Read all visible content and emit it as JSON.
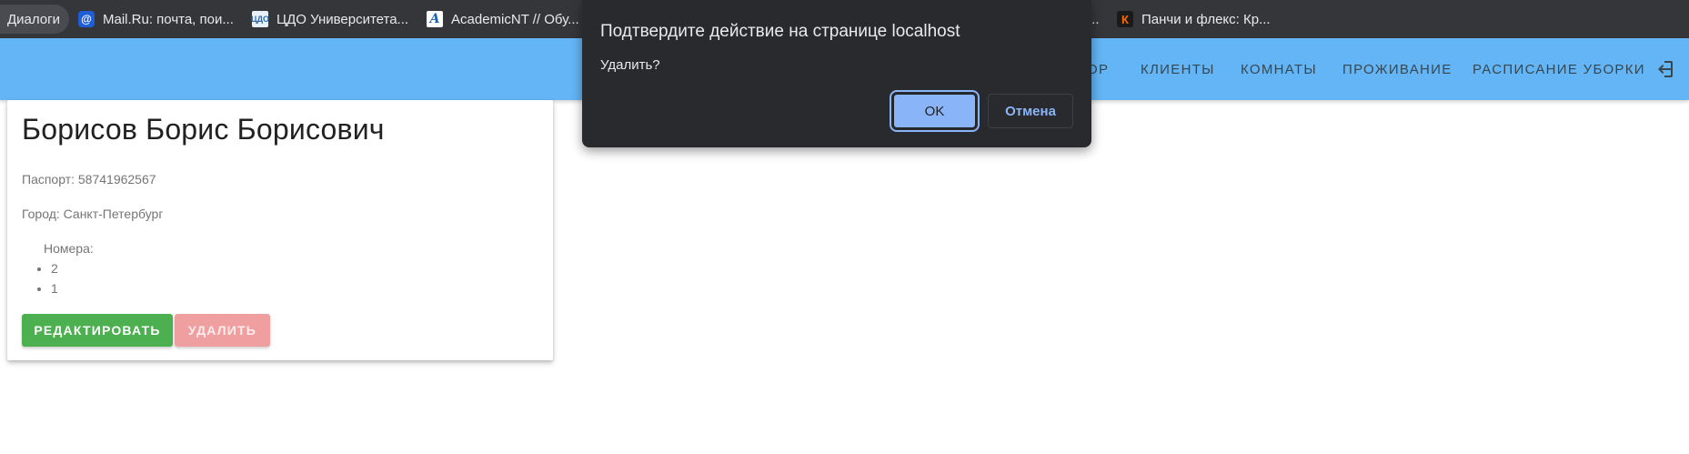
{
  "browser": {
    "bookmarks": [
      {
        "label": "Диалоги",
        "icon": "none"
      },
      {
        "label": "Mail.Ru: почта, пои...",
        "icon": "mailru-icon"
      },
      {
        "label": "ЦДО Университета...",
        "icon": "cdo-icon"
      },
      {
        "label": "AcademicNT // Обу...",
        "icon": "academicnt-icon"
      },
      {
        "label": "...",
        "icon": "none"
      },
      {
        "label": "Панчи и флекс: Кр...",
        "icon": "panchi-icon"
      }
    ]
  },
  "header": {
    "nav": [
      "ОР",
      "КЛИЕНТЫ",
      "КОМНАТЫ",
      "ПРОЖИВАНИЕ",
      "РАСПИСАНИЕ УБОРКИ"
    ],
    "logout_icon": "logout-icon",
    "color": "#64b5f6"
  },
  "client_card": {
    "name": "Борисов Борис Борисович",
    "passport": "Паспорт: 58741962567",
    "city": "Город: Санкт-Петербург",
    "rooms_label": "Номера:",
    "rooms": [
      "2",
      "1"
    ],
    "edit_label": "РЕДАКТИРОВАТЬ",
    "delete_label": "УДАЛИТЬ"
  },
  "confirm_dialog": {
    "title": "Подтвердите действие на странице localhost",
    "message": "Удалить?",
    "ok_label": "OK",
    "cancel_label": "Отмена"
  },
  "colors": {
    "edit_button": "#4caf50",
    "delete_button": "#ef9a9a",
    "dialog_bg": "#292a2d",
    "dialog_accent": "#8ab4f8"
  }
}
